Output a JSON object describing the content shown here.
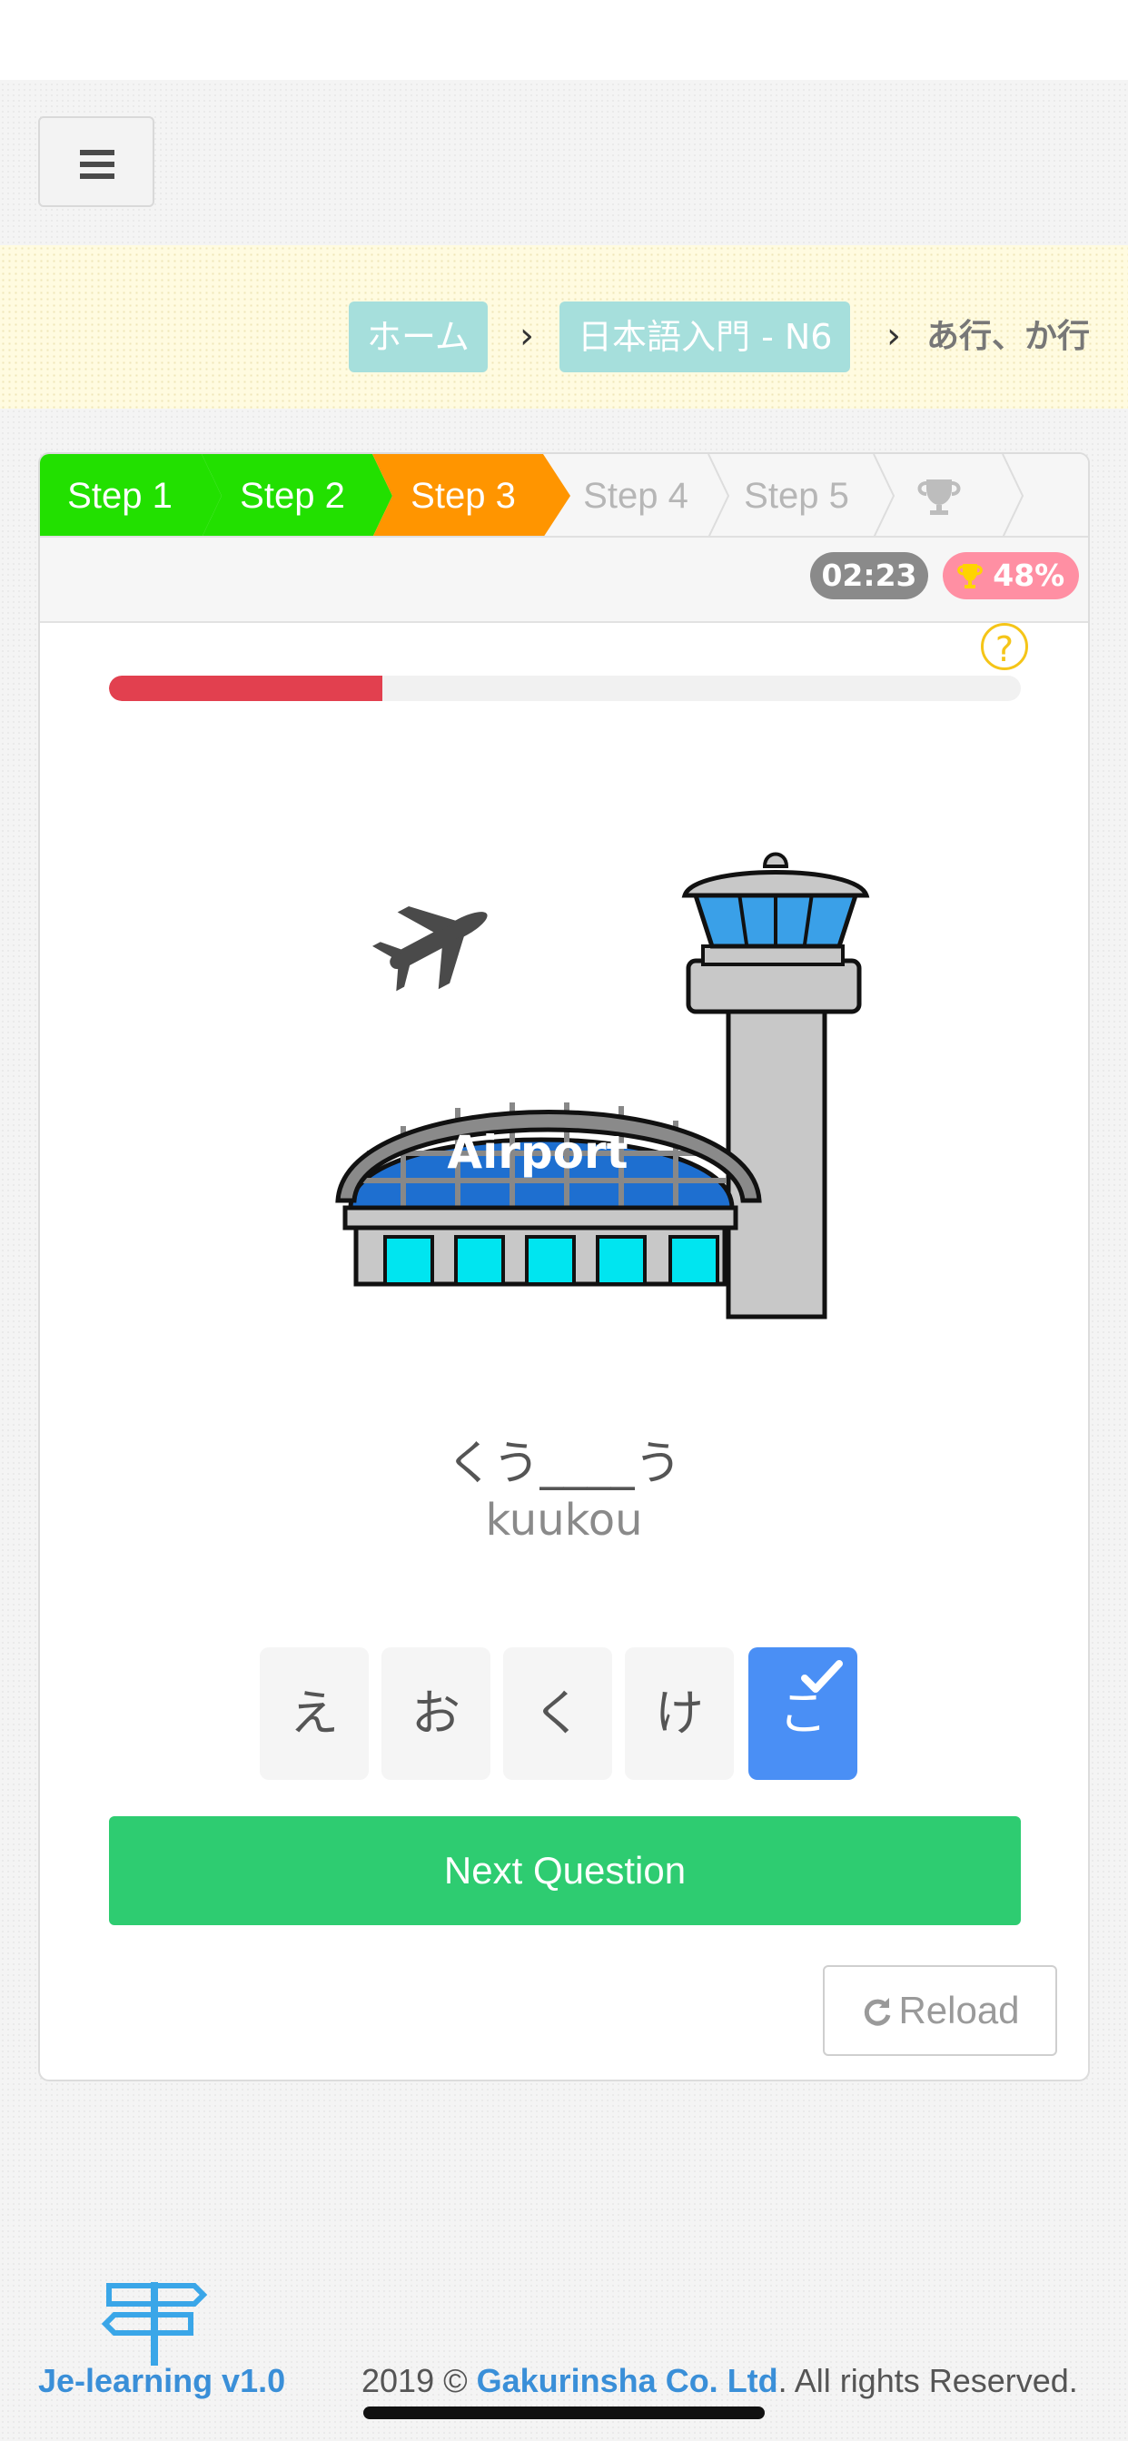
{
  "breadcrumb": {
    "items": [
      "ホーム",
      "日本語入門 - N6"
    ],
    "separator": "›",
    "current": "あ行、か行"
  },
  "steps": [
    {
      "label": "Step 1",
      "state": "done",
      "color": "#22e000"
    },
    {
      "label": "Step 2",
      "state": "done",
      "color": "#22e000"
    },
    {
      "label": "Step 3",
      "state": "active",
      "color": "#ff9500"
    },
    {
      "label": "Step 4",
      "state": "pending"
    },
    {
      "label": "Step 5",
      "state": "pending"
    },
    {
      "label": "",
      "state": "pending",
      "icon": "trophy-icon"
    }
  ],
  "status": {
    "timer": "02:23",
    "score": "48%",
    "score_icon": "trophy-icon"
  },
  "help_symbol": "?",
  "progress": {
    "fraction": 0.3,
    "color": "#e2404f"
  },
  "illustration": {
    "sign_text": "Airport"
  },
  "question": {
    "kana": "くう____う",
    "romaji": "kuukou"
  },
  "choices": [
    {
      "label": "え",
      "selected": false
    },
    {
      "label": "お",
      "selected": false
    },
    {
      "label": "く",
      "selected": false
    },
    {
      "label": "け",
      "selected": false
    },
    {
      "label": "こ",
      "selected": true
    }
  ],
  "buttons": {
    "next": "Next Question",
    "reload": "Reload"
  },
  "footer": {
    "brand": "Je-learning v1.0",
    "copy_prefix": "2019 © ",
    "company": "Gakurinsha Co. Ltd",
    "copy_suffix": ". All rights Reserved."
  },
  "colors": {
    "accent_green": "#2ecc71",
    "selected_blue": "#4a8ff5",
    "crumb_bg": "#a6dfdc",
    "link_blue": "#3a8fd8"
  }
}
